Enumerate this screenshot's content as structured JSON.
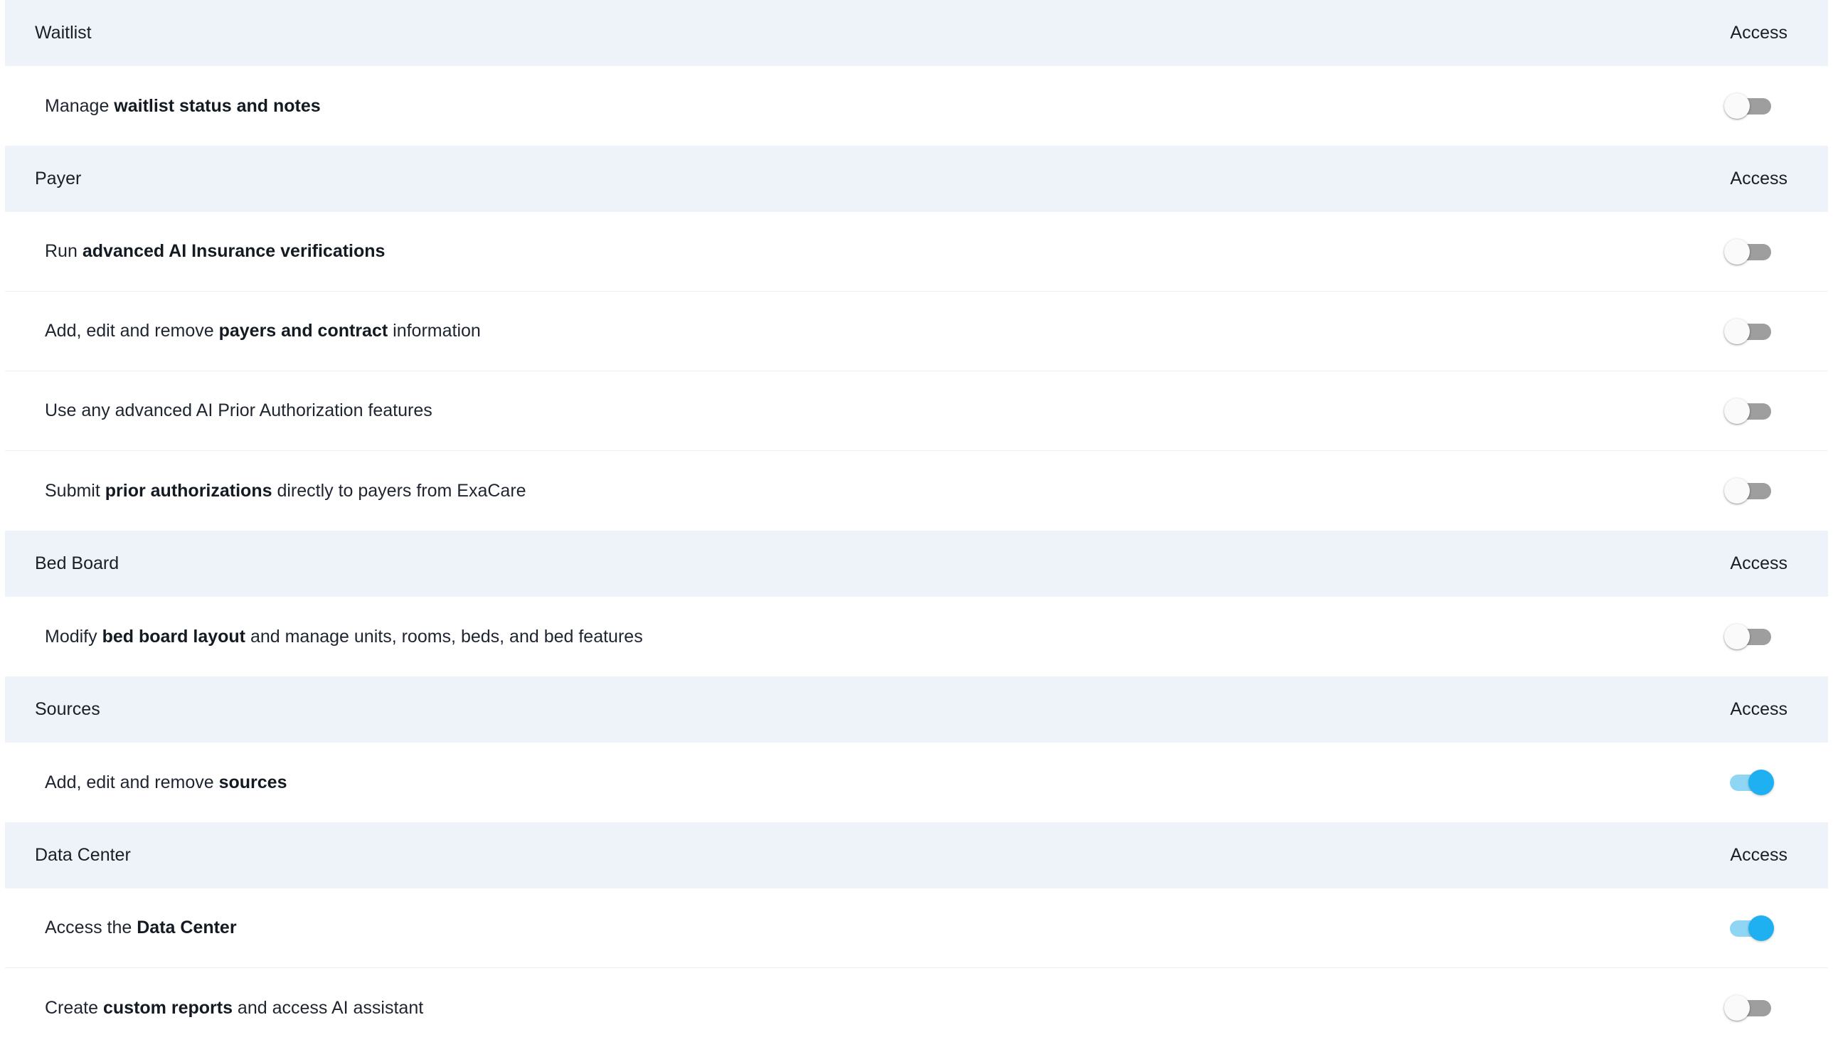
{
  "access_label": "Access",
  "sections": [
    {
      "title": "Waitlist",
      "rows": [
        {
          "parts": [
            {
              "t": "Manage "
            },
            {
              "t": "waitlist status and notes",
              "b": true
            }
          ],
          "enabled": false
        }
      ]
    },
    {
      "title": "Payer",
      "rows": [
        {
          "parts": [
            {
              "t": "Run "
            },
            {
              "t": "advanced AI Insurance verifications",
              "b": true
            }
          ],
          "enabled": false
        },
        {
          "parts": [
            {
              "t": "Add, edit and remove "
            },
            {
              "t": "payers and contract",
              "b": true
            },
            {
              "t": " information"
            }
          ],
          "enabled": false
        },
        {
          "parts": [
            {
              "t": "Use any advanced AI Prior Authorization features"
            }
          ],
          "enabled": false
        },
        {
          "parts": [
            {
              "t": "Submit "
            },
            {
              "t": "prior authorizations",
              "b": true
            },
            {
              "t": " directly to payers from ExaCare"
            }
          ],
          "enabled": false
        }
      ]
    },
    {
      "title": "Bed Board",
      "rows": [
        {
          "parts": [
            {
              "t": "Modify "
            },
            {
              "t": "bed board layout",
              "b": true
            },
            {
              "t": " and manage units, rooms, beds, and bed features"
            }
          ],
          "enabled": false
        }
      ]
    },
    {
      "title": "Sources",
      "rows": [
        {
          "parts": [
            {
              "t": "Add, edit and remove "
            },
            {
              "t": "sources",
              "b": true
            }
          ],
          "enabled": true
        }
      ]
    },
    {
      "title": "Data Center",
      "rows": [
        {
          "parts": [
            {
              "t": "Access the "
            },
            {
              "t": "Data Center",
              "b": true
            }
          ],
          "enabled": true
        },
        {
          "parts": [
            {
              "t": "Create "
            },
            {
              "t": "custom reports",
              "b": true
            },
            {
              "t": " and access AI assistant"
            }
          ],
          "enabled": false
        }
      ]
    }
  ]
}
